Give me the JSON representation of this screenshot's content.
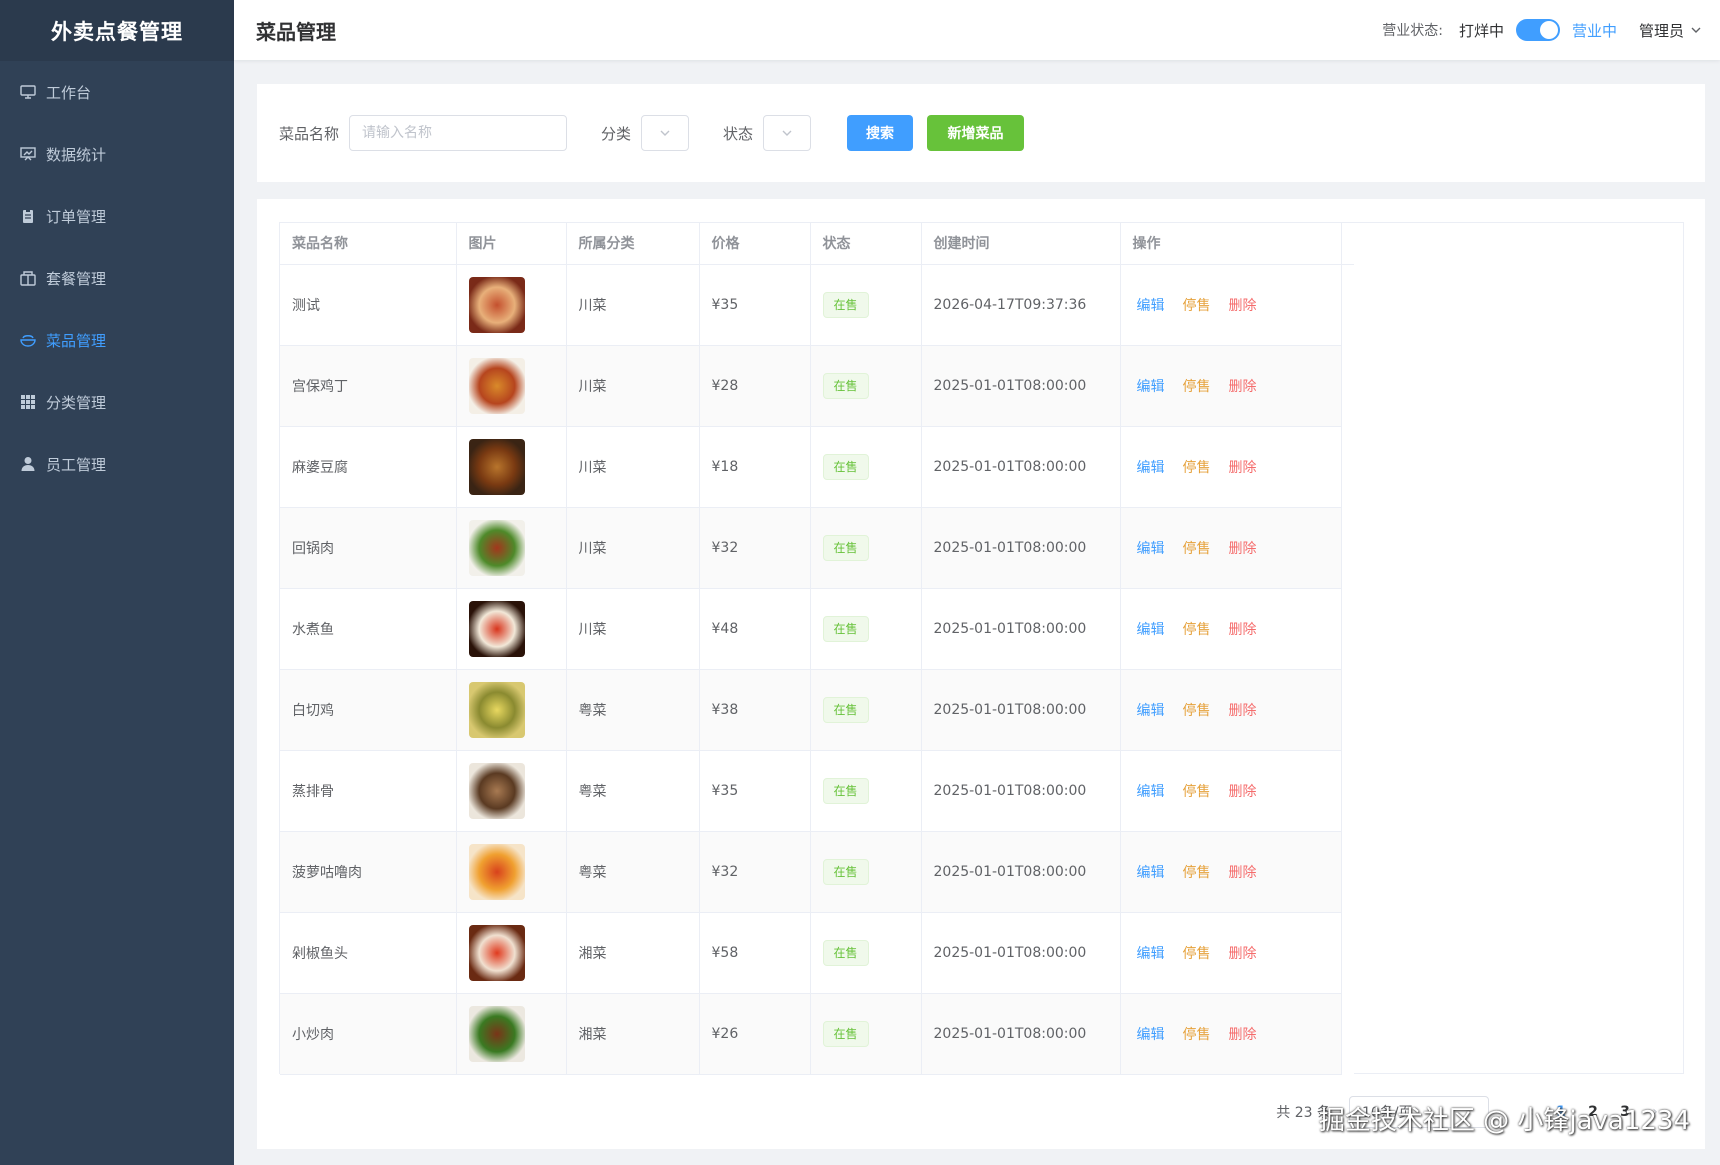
{
  "app": {
    "title": "外卖点餐管理"
  },
  "sidebar": {
    "items": [
      {
        "label": "工作台",
        "icon": "monitor-icon",
        "active": false
      },
      {
        "label": "数据统计",
        "icon": "chart-icon",
        "active": false
      },
      {
        "label": "订单管理",
        "icon": "clipboard-icon",
        "active": false
      },
      {
        "label": "套餐管理",
        "icon": "package-icon",
        "active": false
      },
      {
        "label": "菜品管理",
        "icon": "bowl-icon",
        "active": true
      },
      {
        "label": "分类管理",
        "icon": "grid-icon",
        "active": false
      },
      {
        "label": "员工管理",
        "icon": "user-icon",
        "active": false
      }
    ]
  },
  "header": {
    "title": "菜品管理",
    "biz_label": "营业状态:",
    "biz_off": "打烊中",
    "biz_on": "营业中",
    "biz_toggle_on": true,
    "user": "管理员"
  },
  "search": {
    "name_label": "菜品名称",
    "name_placeholder": "请输入名称",
    "category_label": "分类",
    "status_label": "状态",
    "search_button": "搜索",
    "add_button": "新增菜品"
  },
  "table": {
    "columns": [
      "菜品名称",
      "图片",
      "所属分类",
      "价格",
      "状态",
      "创建时间",
      "操作"
    ],
    "actions": {
      "edit": "编辑",
      "stop": "停售",
      "delete": "删除"
    },
    "rows": [
      {
        "name": "测试",
        "category": "川菜",
        "price": "¥35",
        "status": "在售",
        "created": "2026-04-17T09:37:36",
        "img_colors": [
          "#7a2a18",
          "#c4502e",
          "#e8b07a"
        ]
      },
      {
        "name": "宫保鸡丁",
        "category": "川菜",
        "price": "¥28",
        "status": "在售",
        "created": "2025-01-01T08:00:00",
        "img_colors": [
          "#f4efe6",
          "#d98a2a",
          "#b6451e"
        ]
      },
      {
        "name": "麻婆豆腐",
        "category": "川菜",
        "price": "¥18",
        "status": "在售",
        "created": "2025-01-01T08:00:00",
        "img_colors": [
          "#3a2414",
          "#b8752c",
          "#7a3a12"
        ]
      },
      {
        "name": "回锅肉",
        "category": "川菜",
        "price": "¥32",
        "status": "在售",
        "created": "2025-01-01T08:00:00",
        "img_colors": [
          "#f2f0ea",
          "#a3361c",
          "#4e8a2a"
        ]
      },
      {
        "name": "水煮鱼",
        "category": "川菜",
        "price": "¥48",
        "status": "在售",
        "created": "2025-01-01T08:00:00",
        "img_colors": [
          "#2a1208",
          "#d8341c",
          "#f2e8d8"
        ]
      },
      {
        "name": "白切鸡",
        "category": "粤菜",
        "price": "¥38",
        "status": "在售",
        "created": "2025-01-01T08:00:00",
        "img_colors": [
          "#d8c870",
          "#e8d860",
          "#8a8a30"
        ]
      },
      {
        "name": "蒸排骨",
        "category": "粤菜",
        "price": "¥35",
        "status": "在售",
        "created": "2025-01-01T08:00:00",
        "img_colors": [
          "#ece6dc",
          "#a87a52",
          "#5a3a22"
        ]
      },
      {
        "name": "菠萝咕噜肉",
        "category": "粤菜",
        "price": "¥32",
        "status": "在售",
        "created": "2025-01-01T08:00:00",
        "img_colors": [
          "#f6e4c8",
          "#d8421c",
          "#f0a030"
        ]
      },
      {
        "name": "剁椒鱼头",
        "category": "湘菜",
        "price": "¥58",
        "status": "在售",
        "created": "2025-01-01T08:00:00",
        "img_colors": [
          "#6a2a12",
          "#e03a1e",
          "#f0e0d0"
        ]
      },
      {
        "name": "小炒肉",
        "category": "湘菜",
        "price": "¥26",
        "status": "在售",
        "created": "2025-01-01T08:00:00",
        "img_colors": [
          "#ece8e0",
          "#7a3418",
          "#3a7a22"
        ]
      }
    ]
  },
  "pagination": {
    "total_text": "共 23 条",
    "page_size": "10条/页",
    "pages": [
      "1",
      "2",
      "3"
    ],
    "current": "1"
  },
  "watermark": "掘金技术社区 @ 小锋java1234"
}
